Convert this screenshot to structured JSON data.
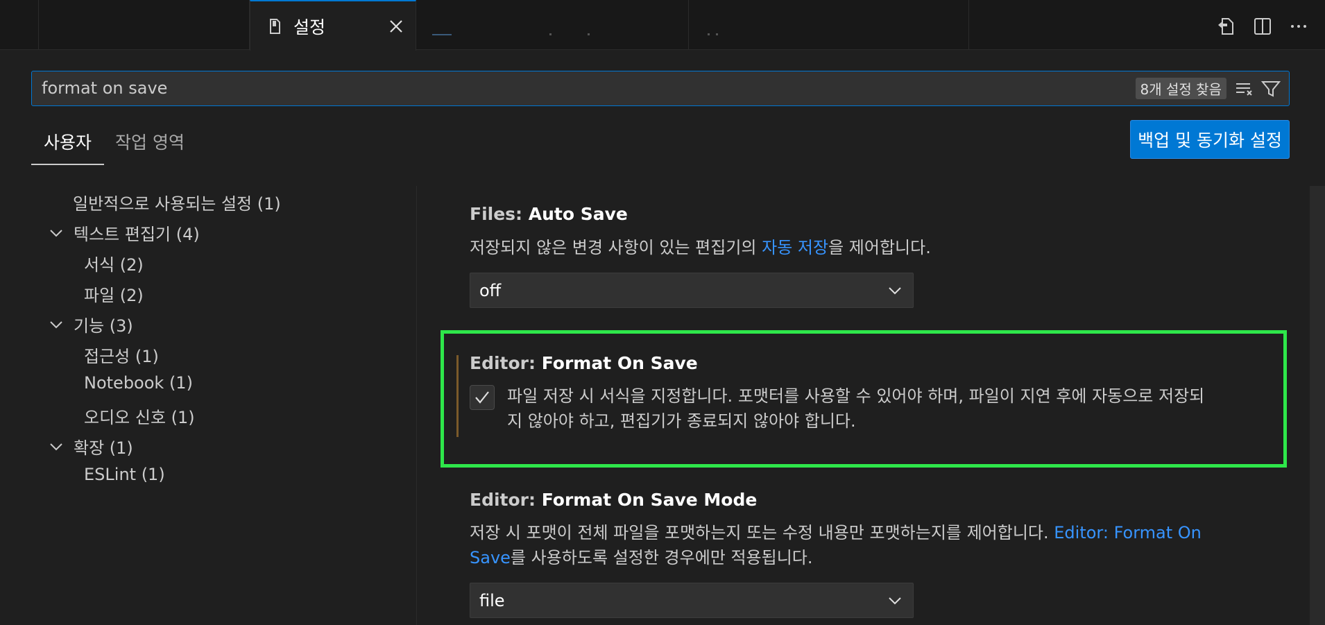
{
  "tabs": {
    "active_label": "설정"
  },
  "search": {
    "value": "format on save",
    "result_count": "8개 설정 찾음"
  },
  "scope_tabs": {
    "user": "사용자",
    "workspace": "작업 영역"
  },
  "sync_button": "백업 및 동기화 설정",
  "toc": [
    {
      "label": "일반적으로 사용되는 설정 (1)",
      "collapsible": false
    },
    {
      "label": "텍스트 편집기 (4)",
      "collapsible": true
    },
    {
      "label": "서식 (2)",
      "collapsible": false
    },
    {
      "label": "파일 (2)",
      "collapsible": false
    },
    {
      "label": "기능 (3)",
      "collapsible": true
    },
    {
      "label": "접근성 (1)",
      "collapsible": false
    },
    {
      "label": "Notebook (1)",
      "collapsible": false
    },
    {
      "label": "오디오 신호 (1)",
      "collapsible": false
    },
    {
      "label": "확장 (1)",
      "collapsible": true
    },
    {
      "label": "ESLint (1)",
      "collapsible": false
    }
  ],
  "settings": {
    "auto_save": {
      "category": "Files: ",
      "name": "Auto Save",
      "desc_before": "저장되지 않은 변경 사항이 있는 편집기의 ",
      "desc_link": "자동 저장",
      "desc_after": "을 제어합니다.",
      "value": "off"
    },
    "format_on_save": {
      "category": "Editor: ",
      "name": "Format On Save",
      "desc_line1": "파일 저장 시 서식을 지정합니다. 포맷터를 사용할 수 있어야 하며, 파일이 지연 후에 자동으로 저장되",
      "desc_line2": "지 않아야 하고, 편집기가 종료되지 않아야 합니다.",
      "checked": true
    },
    "format_on_save_mode": {
      "category": "Editor: ",
      "name": "Format On Save Mode",
      "desc_before": "저장 시 포맷이 전체 파일을 포맷하는지 또는 수정 내용만 포맷하는지를 제어합니다. ",
      "desc_link_1": "Editor: Format On",
      "desc_link_2": "Save",
      "desc_after": "를 사용하도록 설정한 경우에만 적용됩니다.",
      "value": "file"
    }
  },
  "colors": {
    "accent": "#0078d4",
    "highlight": "#2ee64a",
    "link": "#3794ff"
  },
  "icons": [
    "file-icon",
    "close-icon",
    "open-file-icon",
    "split-editor-icon",
    "more-icon",
    "clear-filter-icon",
    "filter-icon",
    "chevron-down-icon",
    "check-icon"
  ]
}
